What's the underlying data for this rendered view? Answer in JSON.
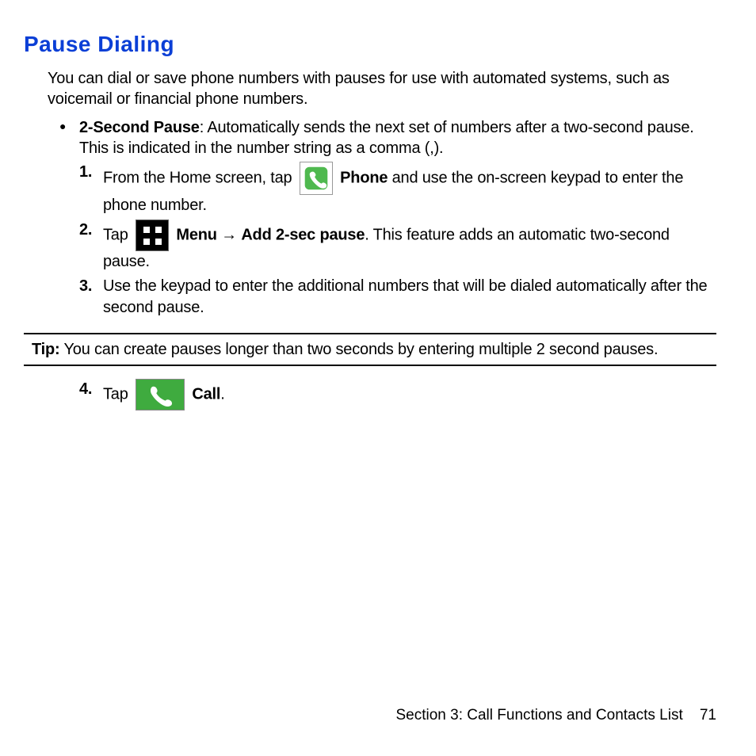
{
  "heading": "Pause Dialing",
  "intro": "You can dial or save phone numbers with pauses for use with automated systems, such as voicemail or financial phone numbers.",
  "bullet": {
    "label": "2-Second Pause",
    "text": ": Automatically sends the next set of numbers after a two-second pause. This is indicated in the number string as a comma (,)."
  },
  "steps": {
    "s1": {
      "num": "1.",
      "pre": "From the Home screen, tap ",
      "bold": "Phone",
      "post": " and use the on-screen keypad to enter the phone number."
    },
    "s2": {
      "num": "2.",
      "pre": "Tap ",
      "bold1": "Menu",
      "arrow": " → ",
      "bold2": "Add 2-sec pause",
      "post": ". This feature adds an automatic two-second pause."
    },
    "s3": {
      "num": "3.",
      "text": "Use the keypad to enter the additional numbers that will be dialed automatically after the second pause."
    },
    "s4": {
      "num": "4.",
      "pre": "Tap ",
      "bold": "Call",
      "post": "."
    }
  },
  "tip": {
    "label": "Tip:",
    "text": " You can create pauses longer than two seconds by entering multiple 2 second pauses."
  },
  "footer": {
    "section": "Section 3:  Call Functions and Contacts List",
    "page": "71"
  }
}
